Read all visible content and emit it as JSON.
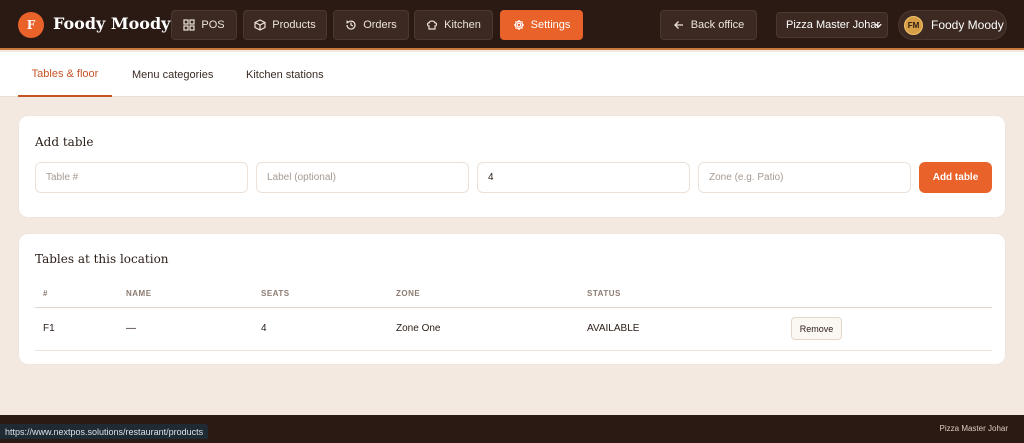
{
  "brand": {
    "logo_letter": "F",
    "name": "Foody Moody"
  },
  "nav": {
    "pos": "POS",
    "products": "Products",
    "orders": "Orders",
    "kitchen": "Kitchen",
    "settings": "Settings",
    "back_office": "Back office"
  },
  "store_select": {
    "value": "Pizza Master Johar"
  },
  "user": {
    "initials": "FM",
    "name": "Foody Moody"
  },
  "tabs": {
    "tables": "Tables & floor",
    "menu_categories": "Menu categories",
    "kitchen_stations": "Kitchen stations"
  },
  "add_table": {
    "title": "Add table",
    "table_placeholder": "Table #",
    "label_placeholder": "Label (optional)",
    "seats_value": "4",
    "zone_placeholder": "Zone (e.g. Patio)",
    "button": "Add table"
  },
  "tables": {
    "title": "Tables at this location",
    "columns": {
      "num": "#",
      "name": "NAME",
      "seats": "SEATS",
      "zone": "ZONE",
      "status": "STATUS"
    },
    "rows": [
      {
        "num": "F1",
        "name": "—",
        "seats": "4",
        "zone": "Zone One",
        "status": "AVAILABLE",
        "action": "Remove"
      }
    ]
  },
  "status_bar": {
    "url": "https://www.nextpos.solutions/restaurant/products",
    "store": "Pizza Master Johar"
  },
  "colors": {
    "accent": "#e8622a",
    "topbar": "#2b1a14",
    "background": "#f3e9e1"
  }
}
